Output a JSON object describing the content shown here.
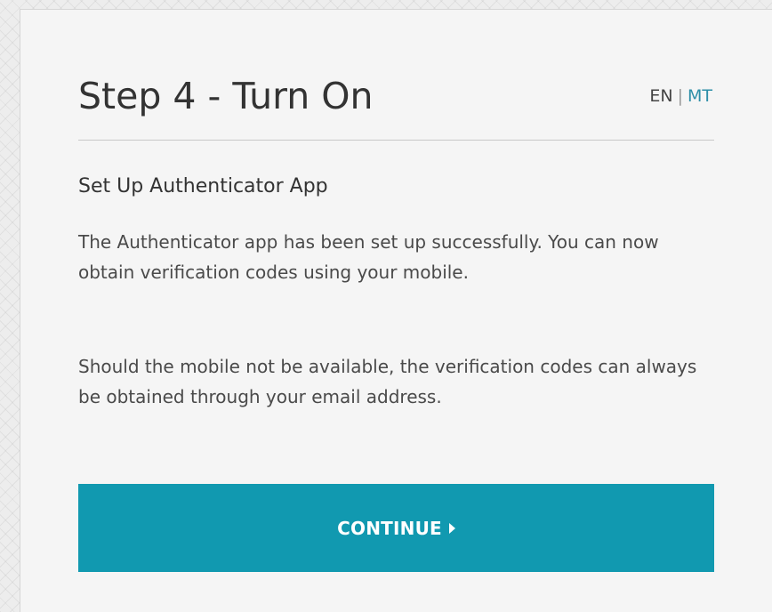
{
  "header": {
    "title": "Step 4 - Turn On",
    "lang_en": "EN",
    "lang_separator": "|",
    "lang_mt": "MT"
  },
  "content": {
    "section_title": "Set Up Authenticator App",
    "paragraph_1": "The Authenticator app has been set up successfully. You can now obtain verification codes using your mobile.",
    "paragraph_2": "Should the mobile not be available, the verification codes can always be obtained through your email address."
  },
  "actions": {
    "continue_label": "CONTINUE"
  },
  "icons": {
    "continue_icon": "caret-right-icon"
  },
  "colors": {
    "accent": "#1199b0",
    "link": "#2e8fa8"
  }
}
